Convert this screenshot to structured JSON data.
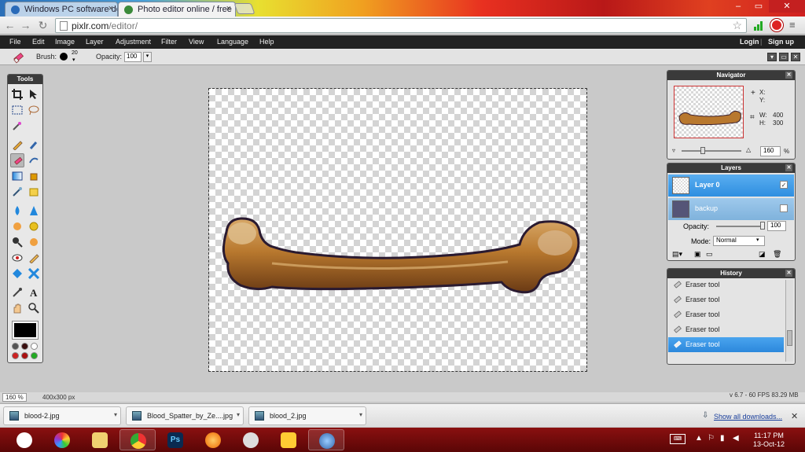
{
  "browser": {
    "tabs": [
      {
        "title": "Windows PC software dow"
      },
      {
        "title": "Photo editor online / free"
      }
    ],
    "url_host": "pixlr.com",
    "url_path": "/editor/"
  },
  "menu": {
    "items": [
      "File",
      "Edit",
      "Image",
      "Layer",
      "Adjustment",
      "Filter",
      "View",
      "Language",
      "Help"
    ],
    "login": "Login",
    "signup": "Sign up"
  },
  "options": {
    "brush_label": "Brush:",
    "brush_size": "20",
    "opacity_label": "Opacity:",
    "opacity_value": "100"
  },
  "tools_panel": {
    "title": "Tools"
  },
  "navigator": {
    "title": "Navigator",
    "x_label": "X:",
    "y_label": "Y:",
    "w_label": "W:",
    "w_value": "400",
    "h_label": "H:",
    "h_value": "300",
    "zoom": "160",
    "zoom_unit": "%"
  },
  "layers": {
    "title": "Layers",
    "items": [
      {
        "name": "Layer 0",
        "checked": "✓"
      },
      {
        "name": "backup",
        "checked": ""
      }
    ],
    "opacity_label": "Opacity:",
    "opacity_value": "100",
    "mode_label": "Mode:",
    "mode_value": "Normal"
  },
  "history": {
    "title": "History",
    "items": [
      "Eraser tool",
      "Eraser tool",
      "Eraser tool",
      "Eraser tool",
      "Eraser tool"
    ]
  },
  "status": {
    "zoom": "160 %",
    "size": "400x300 px",
    "info": "v 6.7 - 60 FPS 83.29 MB"
  },
  "downloads": {
    "items": [
      "blood-2.jpg",
      "Blood_Spatter_by_Ze....jpg",
      "blood_2.jpg"
    ],
    "show_all": "Show all downloads..."
  },
  "taskbar": {
    "time": "11:17 PM",
    "date": "13-Oct-12"
  }
}
